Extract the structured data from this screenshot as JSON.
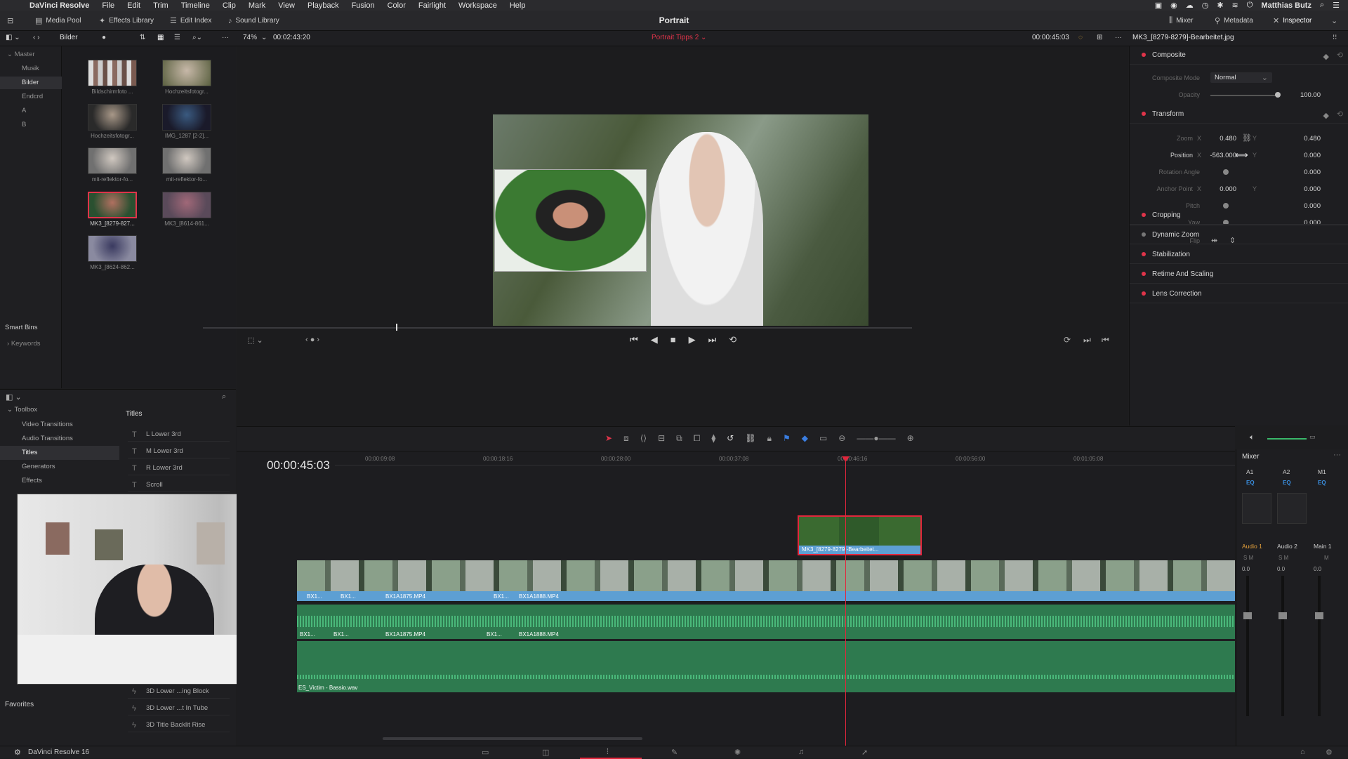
{
  "menubar": {
    "app_name": "DaVinci Resolve",
    "items": [
      "File",
      "Edit",
      "Trim",
      "Timeline",
      "Clip",
      "Mark",
      "View",
      "Playback",
      "Fusion",
      "Color",
      "Fairlight",
      "Workspace",
      "Help"
    ],
    "user": "Matthias Butz"
  },
  "toolbar": {
    "media_pool": "Media Pool",
    "effects_library": "Effects Library",
    "edit_index": "Edit Index",
    "sound_library": "Sound Library",
    "project_title": "Portrait",
    "mixer": "Mixer",
    "metadata": "Metadata",
    "inspector": "Inspector"
  },
  "subbar": {
    "bin_name": "Bilder",
    "zoom": "74%",
    "source_timecode": "00:02:43:20",
    "timeline_name": "Portrait Tipps 2",
    "timeline_timecode": "00:00:45:03",
    "clip_name": "MK3_[8279-8279]-Bearbeitet.jpg"
  },
  "bins": {
    "master": "Master",
    "items": [
      "Musik",
      "Bilder",
      "Endcrd",
      "A",
      "B"
    ],
    "smart_bins": "Smart Bins",
    "keywords": "Keywords"
  },
  "media": [
    {
      "label": "Bildschirmfoto ..."
    },
    {
      "label": "Hochzeitsfotogr..."
    },
    {
      "label": "Hochzeitsfotogr..."
    },
    {
      "label": "IMG_1287 [2-2]..."
    },
    {
      "label": "mit-reflektor-fo..."
    },
    {
      "label": "mit-reflektor-fo..."
    },
    {
      "label": "MK3_[8279-827..."
    },
    {
      "label": "MK3_[8614-861..."
    },
    {
      "label": "MK3_[8624-862..."
    }
  ],
  "inspector": {
    "composite": "Composite",
    "composite_mode_label": "Composite Mode",
    "composite_mode": "Normal",
    "opacity_label": "Opacity",
    "opacity": "100.00",
    "transform": "Transform",
    "zoom_label": "Zoom",
    "zoom_x": "0.480",
    "zoom_y": "0.480",
    "position_label": "Position",
    "position_x": "-563.000",
    "position_y": "0.000",
    "rotation_label": "Rotation Angle",
    "rotation": "0.000",
    "anchor_label": "Anchor Point",
    "anchor_x": "0.000",
    "anchor_y": "0.000",
    "pitch_label": "Pitch",
    "pitch": "0.000",
    "yaw_label": "Yaw",
    "yaw": "0.000",
    "flip_label": "Flip",
    "x": "X",
    "y": "Y",
    "sections": [
      "Cropping",
      "Dynamic Zoom",
      "Stabilization",
      "Retime And Scaling",
      "Lens Correction"
    ]
  },
  "fxpanel": {
    "toolbox": "Toolbox",
    "items": [
      "Video Transitions",
      "Audio Transitions",
      "Titles",
      "Generators",
      "Effects"
    ],
    "titles_header": "Titles",
    "titles": [
      "L Lower 3rd",
      "M Lower 3rd",
      "R Lower 3rd",
      "Scroll"
    ],
    "titles_bottom": [
      "3D Lower ...ing Block",
      "3D Lower ...t In Tube",
      "3D Title Backlit Rise"
    ],
    "favorites": "Favorites"
  },
  "timeline": {
    "timecode": "00:00:45:03",
    "ruler": [
      "00:00:09:08",
      "00:00:18:16",
      "00:00:28:00",
      "00:00:37:08",
      "00:00:46:16",
      "00:00:56:00",
      "00:01:05:08"
    ],
    "v2_clip": "MK3_[8279-8279]-Bearbeitet...",
    "v1_clips": [
      "BX1...",
      "BX1...",
      "BX1A1875.MP4",
      "BX1...",
      "BX1A1888.MP4"
    ],
    "a1_clips": [
      "BX1...",
      "BX1...",
      "BX1A1875.MP4",
      "BX1...",
      "BX1A1888.MP4"
    ],
    "a2_clip": "ES_Victim - Bassio.wav"
  },
  "mixer": {
    "title": "Mixer",
    "channels": [
      "A1",
      "A2",
      "M1"
    ],
    "eq": "EQ",
    "names": [
      "Audio 1",
      "Audio 2",
      "Main 1"
    ],
    "values": [
      "0.0",
      "0.0",
      "0.0"
    ]
  },
  "footer": {
    "version": "DaVinci Resolve 16"
  },
  "colors": {
    "accent_red": "#e0344a",
    "video_track": "#5d9fd3",
    "audio_track": "#3a9a6a",
    "playhead": "#e2263c"
  }
}
